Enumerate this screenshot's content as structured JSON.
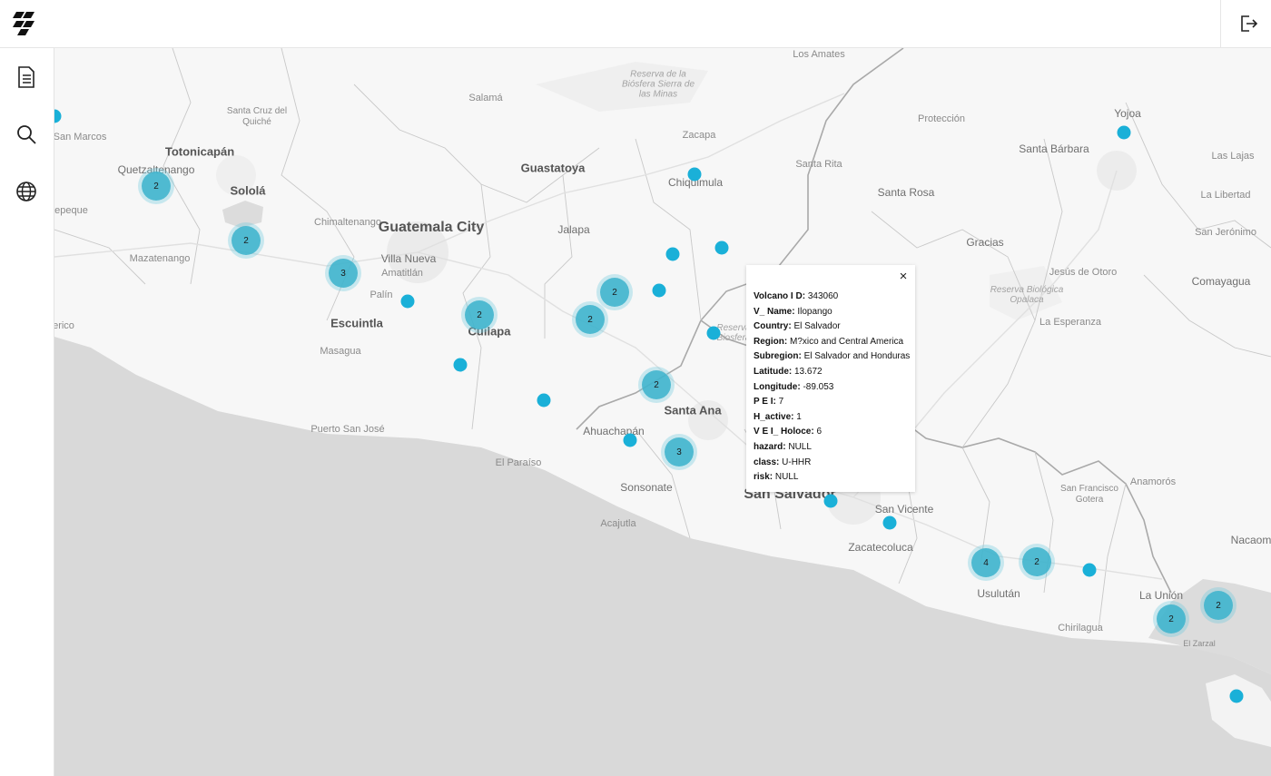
{
  "header": {
    "logo_icon": "logo-icon",
    "logout_icon": "logout-icon"
  },
  "sidebar": {
    "items": [
      {
        "icon": "document-icon"
      },
      {
        "icon": "search-icon"
      },
      {
        "icon": "globe-icon"
      }
    ]
  },
  "map": {
    "labels": {
      "san_marcos": "San Marcos",
      "totonicapan": "Totonicapán",
      "quetzaltenango": "Quetzaltenango",
      "santa_cruz": "Santa Cruz del Quiché",
      "solola": "Sololá",
      "chimaltenango": "Chimaltenango",
      "mazatenango": "Mazatenango",
      "guatemala_city": "Guatemala City",
      "villa_nueva": "Villa Nueva",
      "amatitlan": "Amatitlán",
      "palin": "Palín",
      "escuintla": "Escuintla",
      "masagua": "Masagua",
      "puerto_san_jose": "Puerto San José",
      "salama": "Salamá",
      "guastatoya": "Guastatoya",
      "jalapa": "Jalapa",
      "cuilapa": "Cuilapa",
      "reserva_minas": "Reserva de la Biósfera Sierra de las Minas",
      "zacapa": "Zacapa",
      "chiquimula": "Chiquimula",
      "los_amates": "Los Amates",
      "proteccion": "Protección",
      "santa_rita": "Santa Rita",
      "santa_barbara": "Santa Bárbara",
      "yojoa": "Yojoa",
      "las_lajas": "Las Lajas",
      "la_libertad": "La Libertad",
      "san_jeronimo": "San Jerónimo",
      "santa_rosa": "Santa Rosa",
      "gracias": "Gracias",
      "jesus_otoro": "Jesús de Otoro",
      "comayagua": "Comayagua",
      "reserva_opalaca": "Reserva Biológica Opalaca",
      "la_esperanza": "La Esperanza",
      "santa_ana": "Santa Ana",
      "ahuachapan": "Ahuachapán",
      "el_paraiso": "El Paraíso",
      "sonsonate": "Sonsonate",
      "acajutla": "Acajutla",
      "san_salvador": "San Salvador",
      "san_vicente": "San Vicente",
      "zacatecoluca": "Zacatecoluca",
      "usulutan": "Usulután",
      "chirilagua": "Chirilagua",
      "san_francisco": "San Francisco Gotera",
      "anamoros": "Anamorós",
      "la_union": "La Unión",
      "nacaome": "Nacaom",
      "el_zarcal": "El Zarzal",
      "erico": "erico",
      "tepeque": "tepeque",
      "reserva_fragment": "Reserva Biosfera"
    },
    "clusters": [
      "2",
      "2",
      "3",
      "2",
      "2",
      "2",
      "2",
      "3",
      "4",
      "2",
      "2",
      "2"
    ]
  },
  "popup": {
    "close_label": "×",
    "fields": [
      {
        "key": "Volcano I D:",
        "value": "343060"
      },
      {
        "key": "V_ Name:",
        "value": "Ilopango"
      },
      {
        "key": "Country:",
        "value": "El Salvador"
      },
      {
        "key": "Region:",
        "value": "M?xico and Central America"
      },
      {
        "key": "Subregion:",
        "value": "El Salvador and Honduras"
      },
      {
        "key": "Latitude:",
        "value": "13.672"
      },
      {
        "key": "Longitude:",
        "value": "-89.053"
      },
      {
        "key": "P E I:",
        "value": "7"
      },
      {
        "key": "H_active:",
        "value": "1"
      },
      {
        "key": "V E I_ Holoce:",
        "value": "6"
      },
      {
        "key": "hazard:",
        "value": "NULL"
      },
      {
        "key": "class:",
        "value": "U-HHR"
      },
      {
        "key": "risk:",
        "value": "NULL"
      }
    ]
  }
}
